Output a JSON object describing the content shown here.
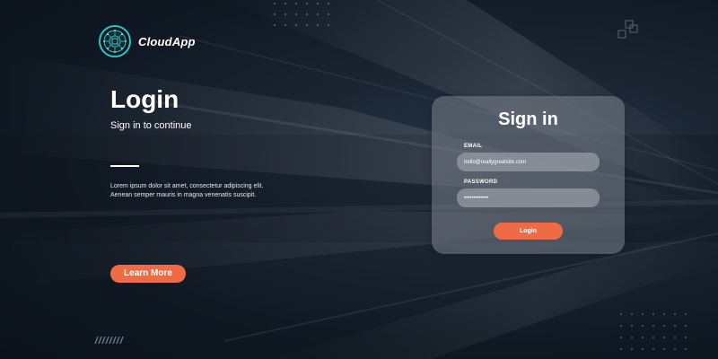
{
  "brand": {
    "name": "CloudApp",
    "icon": "circuit-globe-icon"
  },
  "hero": {
    "title": "Login",
    "subtitle": "Sign in to continue",
    "description_line1": "Lorem ipsum dolor sit amet, consectetur adipiscing elit.",
    "description_line2": "Aenean semper mauris in magna venenatis suscipit.",
    "learn_more_label": "Learn More"
  },
  "signin": {
    "title": "Sign in",
    "email_label": "EMAIL",
    "email_value": "hello@reallygreatsite.com",
    "password_label": "PASSWORD",
    "password_value": "•••••••••••••",
    "login_label": "Login"
  },
  "colors": {
    "accent": "#ef6b46",
    "logo_teal": "#2ec4c4",
    "background": "#101923"
  }
}
